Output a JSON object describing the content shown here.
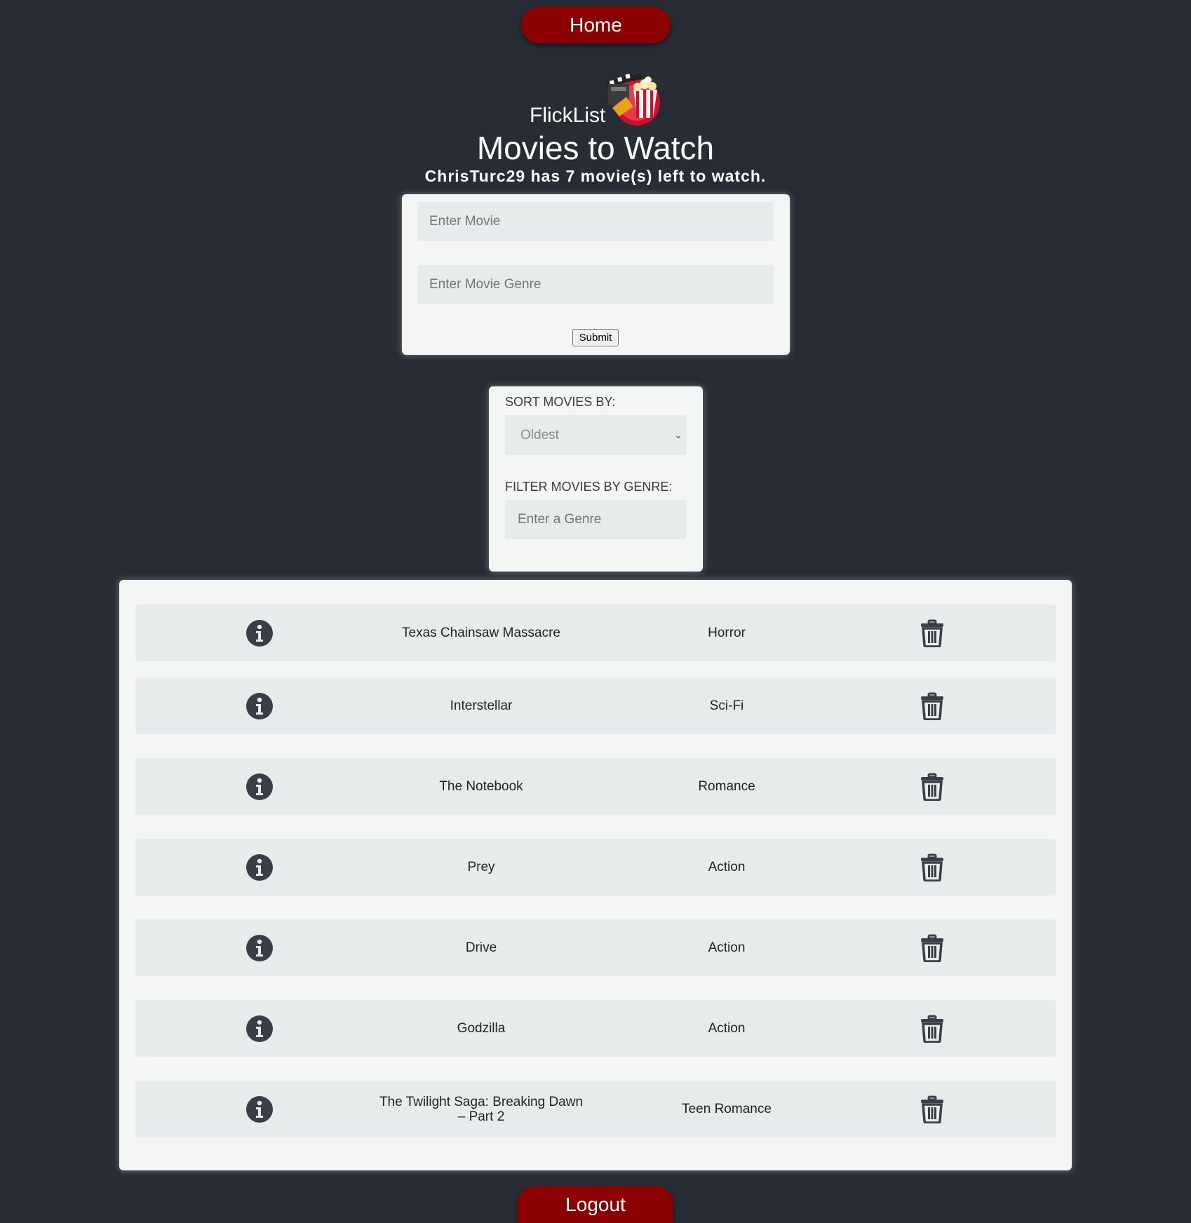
{
  "nav": {
    "home_label": "Home",
    "logout_label": "Logout"
  },
  "header": {
    "brand": "FlickList",
    "title": "Movies to Watch",
    "subtitle": "ChrisTurc29 has 7 movie(s) left to watch."
  },
  "add_form": {
    "movie_placeholder": "Enter Movie",
    "movie_value": "",
    "genre_placeholder": "Enter Movie Genre",
    "genre_value": "",
    "submit_label": "Submit"
  },
  "filters": {
    "sort_label": "SORT MOVIES BY:",
    "sort_selected": "Oldest",
    "filter_label": "FILTER MOVIES BY GENRE:",
    "genre_placeholder": "Enter a Genre",
    "genre_value": ""
  },
  "movies": [
    {
      "title": "Texas Chainsaw Massacre",
      "genre": "Horror"
    },
    {
      "title": "Interstellar",
      "genre": "Sci-Fi"
    },
    {
      "title": "The Notebook",
      "genre": "Romance"
    },
    {
      "title": "Prey",
      "genre": "Action"
    },
    {
      "title": "Drive",
      "genre": "Action"
    },
    {
      "title": "Godzilla",
      "genre": "Action"
    },
    {
      "title": "The Twilight Saga: Breaking Dawn – Part 2",
      "genre": "Teen Romance"
    }
  ],
  "icons": {
    "row_info": "info-icon",
    "row_delete": "trash-icon",
    "logo": "popcorn-clapperboard-logo"
  },
  "colors": {
    "background": "#282c34",
    "accent": "#8b0000",
    "card": "#f4f6f6",
    "row": "#e8ebec",
    "icon": "#3a3f47"
  }
}
